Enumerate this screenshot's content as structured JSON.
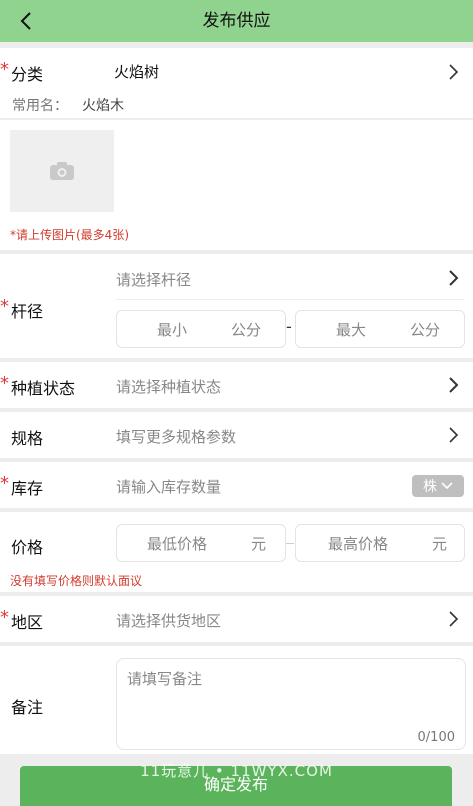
{
  "header": {
    "title": "发布供应"
  },
  "required_mark": "*",
  "category": {
    "label": "分类",
    "value": "火焰树",
    "common_name_label": "常用名：",
    "common_name": "火焰木"
  },
  "upload": {
    "note": "*请上传图片(最多4张)"
  },
  "trunk": {
    "label": "杆径",
    "select_hint": "请选择杆径",
    "min_placeholder": "最小",
    "min_unit": "公分",
    "dash": "-",
    "max_placeholder": "最大",
    "max_unit": "公分"
  },
  "planting": {
    "label": "种植状态",
    "hint": "请选择种植状态"
  },
  "spec": {
    "label": "规格",
    "hint": "填写更多规格参数"
  },
  "stock": {
    "label": "库存",
    "hint": "请输入库存数量",
    "unit": "株"
  },
  "price": {
    "label": "价格",
    "min_placeholder": "最低价格",
    "min_unit": "元",
    "max_placeholder": "最高价格",
    "max_unit": "元",
    "note": "没有填写价格则默认面议"
  },
  "region": {
    "label": "地区",
    "hint": "请选择供货地区"
  },
  "remark": {
    "label": "备注",
    "placeholder": "请填写备注",
    "counter": "0/100"
  },
  "submit_label": "确定发布",
  "watermark": "11玩意儿 • 11WYX.COM",
  "colors": {
    "header": "#8fd38f",
    "submit": "#5bb45b",
    "required": "#e03a3a"
  }
}
